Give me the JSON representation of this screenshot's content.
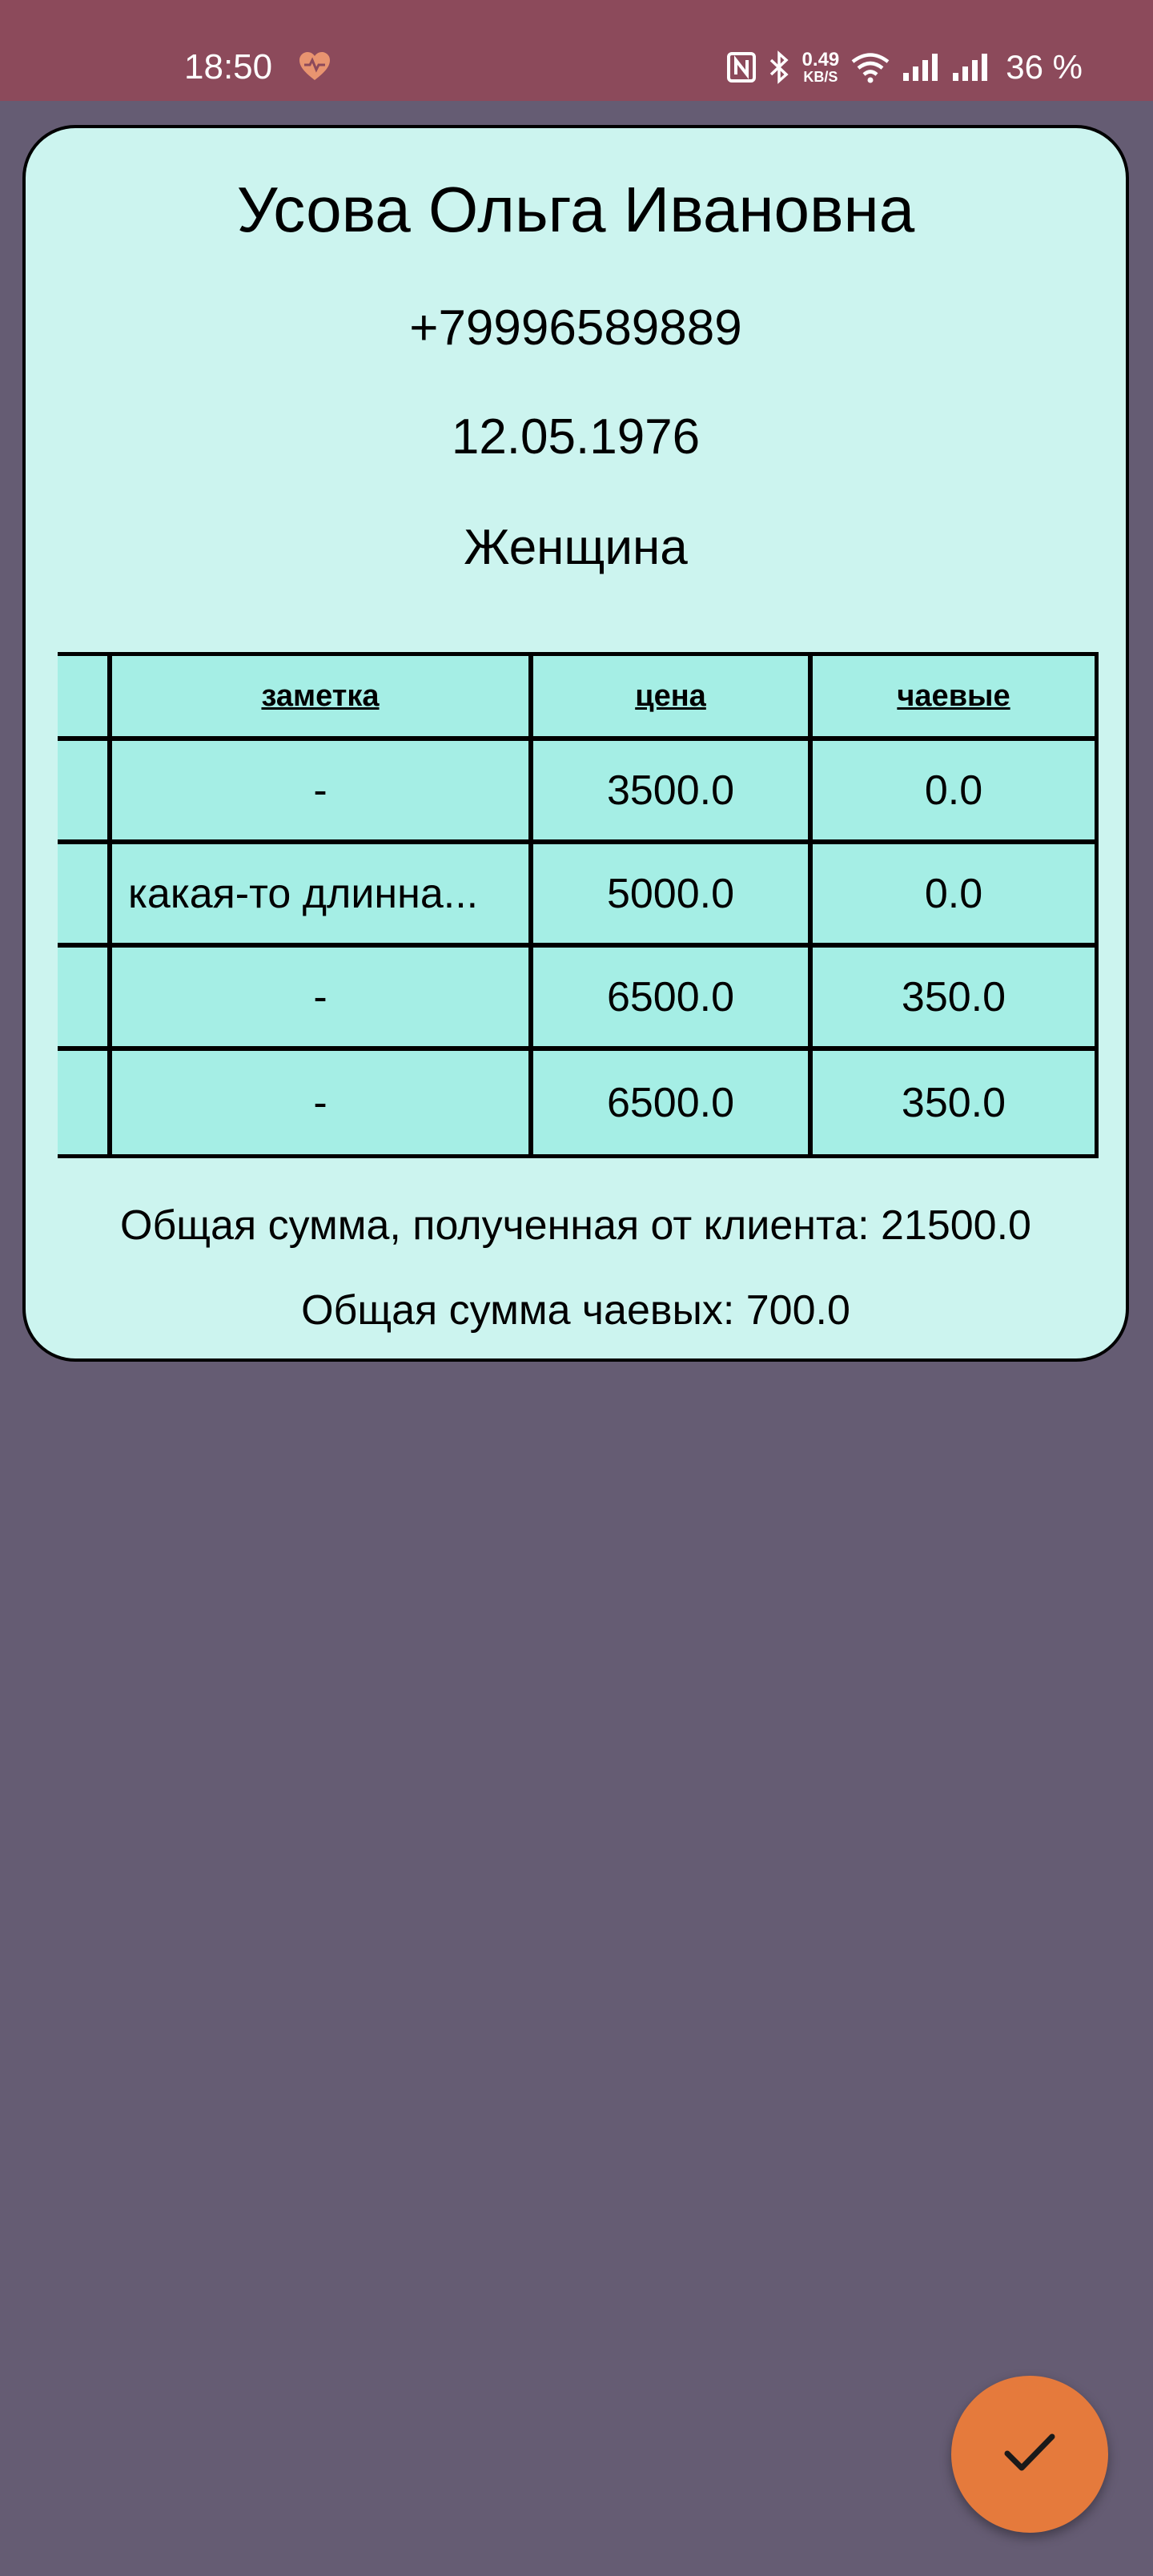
{
  "status_bar": {
    "time": "18:50",
    "net_speed_value": "0.49",
    "net_speed_unit": "KB/S",
    "battery": "36 %"
  },
  "client": {
    "name": "Усова Ольга Ивановна",
    "phone": "+79996589889",
    "birth_date": "12.05.1976",
    "gender": "Женщина"
  },
  "table": {
    "headers": [
      "",
      "заметка",
      "цена",
      "чаевые"
    ],
    "rows": [
      {
        "note": "-",
        "price": "3500.0",
        "tips": "0.0"
      },
      {
        "note": "какая-то длинна...",
        "price": "5000.0",
        "tips": "0.0"
      },
      {
        "note": "-",
        "price": "6500.0",
        "tips": "350.0"
      },
      {
        "note": "-",
        "price": "6500.0",
        "tips": "350.0"
      }
    ]
  },
  "totals": {
    "total_received": "Общая сумма, полученная от клиента: 21500.0",
    "total_tips": "Общая сумма чаевых: 700.0"
  },
  "colors": {
    "status_bar": "#8c4a5b",
    "background": "#655c73",
    "card": "#ccf4ef",
    "table_cell": "#a5eee5",
    "fab": "#e57a3c"
  },
  "icons": {
    "status_heart": "heart-icon",
    "nfc": "nfc-icon",
    "bluetooth": "bluetooth-icon",
    "wifi": "wifi-icon",
    "signal": "signal-icon",
    "fab": "check-icon"
  }
}
